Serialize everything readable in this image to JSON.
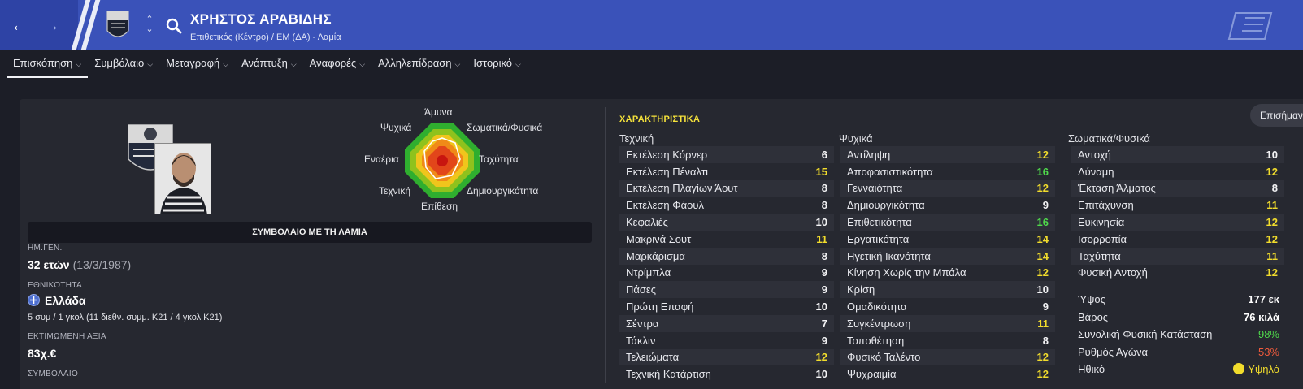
{
  "header": {
    "player_name": "ΧΡΗΣΤΟΣ ΑΡΑΒΙΔΗΣ",
    "subtitle": "Επιθετικός (Κέντρο) / ΕΜ (ΔΑ) - Λαμία",
    "accent_color": "#3a52b9",
    "icons": [
      "back-arrow-icon",
      "forward-arrow-icon",
      "club-crest-icon",
      "up-down-chevron-icon",
      "search-icon",
      "game-logo-icon"
    ]
  },
  "tabs": [
    {
      "label": "Επισκόπηση",
      "active": true
    },
    {
      "label": "Συμβόλαιο"
    },
    {
      "label": "Μεταγραφή"
    },
    {
      "label": "Ανάπτυξη"
    },
    {
      "label": "Αναφορές"
    },
    {
      "label": "Αλληλεπίδραση"
    },
    {
      "label": "Ιστορικό"
    }
  ],
  "radar": {
    "labels": {
      "top": "Άμυνα",
      "top_left": "Ψυχικά",
      "top_right": "Σωματικά/Φυσικά",
      "left": "Εναέρια",
      "right": "Ταχύτητα",
      "bottom_left": "Τεχνική",
      "bottom_right": "Δημιουργικότητα",
      "bottom": "Επίθεση"
    }
  },
  "overview": {
    "contract_bar": "ΣΥΜΒΟΛΑΙΟ ΜΕ ΤΗ ΛΑΜΙΑ",
    "dob_label": "ΗΜ.ΓΕΝ.",
    "age": "32 ετών",
    "dob": "(13/3/1987)",
    "nationality_label": "ΕΘΝΙΚΟΤΗΤΑ",
    "nationality": "Ελλάδα",
    "caps": "5 συμ / 1 γκολ (11 διεθν. συμμ. Κ21 / 4 γκολ Κ21)",
    "value_label": "ΕΚΤΙΜΩΜΕΝΗ ΑΞΙΑ",
    "value": "83χ.€",
    "contract_label": "ΣΥΜΒΟΛΑΙΟ"
  },
  "attributes": {
    "title": "ΧΑΡΑΚΤΗΡΙΣΤΙΚΑ",
    "notes_button": "Επισήμανση",
    "technical": {
      "header": "Τεχνική",
      "items": [
        {
          "name": "Εκτέλεση Κόρνερ",
          "value": "6",
          "tier": "w"
        },
        {
          "name": "Εκτέλεση Πέναλτι",
          "value": "15",
          "tier": "y"
        },
        {
          "name": "Εκτέλεση Πλαγίων Άουτ",
          "value": "8",
          "tier": "w"
        },
        {
          "name": "Εκτέλεση Φάουλ",
          "value": "8",
          "tier": "w"
        },
        {
          "name": "Κεφαλιές",
          "value": "10",
          "tier": "w"
        },
        {
          "name": "Μακρινά Σουτ",
          "value": "11",
          "tier": "y"
        },
        {
          "name": "Μαρκάρισμα",
          "value": "8",
          "tier": "w"
        },
        {
          "name": "Ντρίμπλα",
          "value": "9",
          "tier": "w"
        },
        {
          "name": "Πάσες",
          "value": "9",
          "tier": "w"
        },
        {
          "name": "Πρώτη Επαφή",
          "value": "10",
          "tier": "w"
        },
        {
          "name": "Σέντρα",
          "value": "7",
          "tier": "w"
        },
        {
          "name": "Τάκλιν",
          "value": "9",
          "tier": "w"
        },
        {
          "name": "Τελειώματα",
          "value": "12",
          "tier": "y"
        },
        {
          "name": "Τεχνική Κατάρτιση",
          "value": "10",
          "tier": "w"
        }
      ]
    },
    "mental": {
      "header": "Ψυχικά",
      "items": [
        {
          "name": "Αντίληψη",
          "value": "12",
          "tier": "y"
        },
        {
          "name": "Αποφασιστικότητα",
          "value": "16",
          "tier": "g"
        },
        {
          "name": "Γενναιότητα",
          "value": "12",
          "tier": "y"
        },
        {
          "name": "Δημιουργικότητα",
          "value": "9",
          "tier": "w"
        },
        {
          "name": "Επιθετικότητα",
          "value": "16",
          "tier": "g"
        },
        {
          "name": "Εργατικότητα",
          "value": "14",
          "tier": "y"
        },
        {
          "name": "Ηγετική Ικανότητα",
          "value": "14",
          "tier": "y"
        },
        {
          "name": "Κίνηση Χωρίς την Μπάλα",
          "value": "12",
          "tier": "y"
        },
        {
          "name": "Κρίση",
          "value": "10",
          "tier": "w"
        },
        {
          "name": "Ομαδικότητα",
          "value": "9",
          "tier": "w"
        },
        {
          "name": "Συγκέντρωση",
          "value": "11",
          "tier": "y"
        },
        {
          "name": "Τοποθέτηση",
          "value": "8",
          "tier": "w"
        },
        {
          "name": "Φυσικό Ταλέντο",
          "value": "12",
          "tier": "y"
        },
        {
          "name": "Ψυχραιμία",
          "value": "12",
          "tier": "y"
        }
      ]
    },
    "physical": {
      "header": "Σωματικά/Φυσικά",
      "items": [
        {
          "name": "Αντοχή",
          "value": "10",
          "tier": "w"
        },
        {
          "name": "Δύναμη",
          "value": "12",
          "tier": "y"
        },
        {
          "name": "Έκταση Άλματος",
          "value": "8",
          "tier": "w"
        },
        {
          "name": "Επιτάχυνση",
          "value": "11",
          "tier": "y"
        },
        {
          "name": "Ευκινησία",
          "value": "12",
          "tier": "y"
        },
        {
          "name": "Ισορροπία",
          "value": "12",
          "tier": "y"
        },
        {
          "name": "Ταχύτητα",
          "value": "11",
          "tier": "y"
        },
        {
          "name": "Φυσική Αντοχή",
          "value": "12",
          "tier": "y"
        }
      ]
    },
    "details": [
      {
        "name": "Ύψος",
        "value": "177 εκ",
        "style": "bold"
      },
      {
        "name": "Βάρος",
        "value": "76 κιλά",
        "style": "bold"
      },
      {
        "name": "Συνολική Φυσική Κατάσταση",
        "value": "98%",
        "style": "pg"
      },
      {
        "name": "Ρυθμός Αγώνα",
        "value": "53%",
        "style": "pr"
      },
      {
        "name": "Ηθικό",
        "value": "Υψηλό",
        "style": "py"
      }
    ]
  }
}
